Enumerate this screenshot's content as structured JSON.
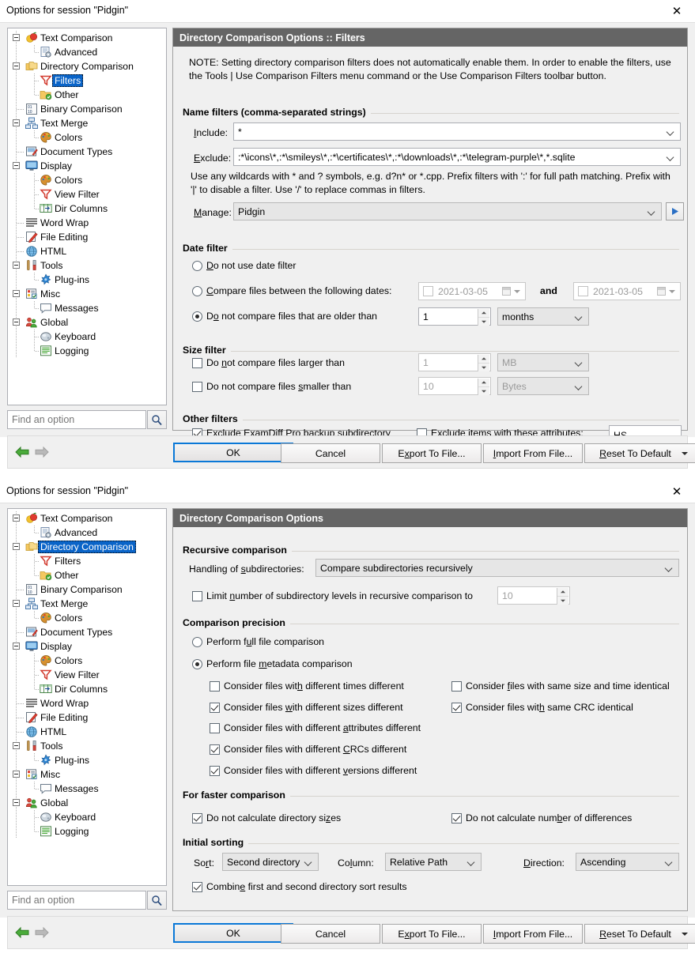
{
  "window": {
    "title": "Options for session \"Pidgin\"",
    "close_icon": "close-icon"
  },
  "tree": {
    "items": [
      {
        "label": "Text Comparison",
        "level": 0,
        "icon": "text-comparison-icon",
        "expander": true
      },
      {
        "label": "Advanced",
        "level": 1,
        "icon": "advanced-icon",
        "expander": false
      },
      {
        "label": "Directory Comparison",
        "level": 0,
        "icon": "directory-comparison-icon",
        "expander": true
      },
      {
        "label": "Filters",
        "level": 1,
        "icon": "filters-icon",
        "expander": false
      },
      {
        "label": "Other",
        "level": 1,
        "icon": "other-folder-icon",
        "expander": false
      },
      {
        "label": "Binary Comparison",
        "level": 0,
        "icon": "binary-comparison-icon",
        "expander": false
      },
      {
        "label": "Text Merge",
        "level": 0,
        "icon": "text-merge-icon",
        "expander": true
      },
      {
        "label": "Colors",
        "level": 1,
        "icon": "colors-palette-icon",
        "expander": false
      },
      {
        "label": "Document Types",
        "level": 0,
        "icon": "document-types-icon",
        "expander": false
      },
      {
        "label": "Display",
        "level": 0,
        "icon": "display-monitor-icon",
        "expander": true
      },
      {
        "label": "Colors",
        "level": 1,
        "icon": "colors-palette-icon",
        "expander": false
      },
      {
        "label": "View Filter",
        "level": 1,
        "icon": "view-filter-icon",
        "expander": false
      },
      {
        "label": "Dir Columns",
        "level": 1,
        "icon": "dir-columns-icon",
        "expander": false
      },
      {
        "label": "Word Wrap",
        "level": 0,
        "icon": "word-wrap-icon",
        "expander": false
      },
      {
        "label": "File Editing",
        "level": 0,
        "icon": "file-editing-icon",
        "expander": false
      },
      {
        "label": "HTML",
        "level": 0,
        "icon": "html-globe-icon",
        "expander": false
      },
      {
        "label": "Tools",
        "level": 0,
        "icon": "tools-icon",
        "expander": true
      },
      {
        "label": "Plug-ins",
        "level": 1,
        "icon": "plugins-icon",
        "expander": false
      },
      {
        "label": "Misc",
        "level": 0,
        "icon": "misc-icon",
        "expander": true
      },
      {
        "label": "Messages",
        "level": 1,
        "icon": "messages-icon",
        "expander": false
      },
      {
        "label": "Global",
        "level": 0,
        "icon": "global-users-icon",
        "expander": true
      },
      {
        "label": "Keyboard",
        "level": 1,
        "icon": "keyboard-icon",
        "expander": false
      },
      {
        "label": "Logging",
        "level": 1,
        "icon": "logging-icon",
        "expander": false
      }
    ],
    "selected_index_dialog1": 3,
    "selected_index_dialog2": 2
  },
  "search": {
    "placeholder": "Find an option",
    "icon": "search-magnifier-icon"
  },
  "footer": {
    "back_icon": "back-arrow-icon",
    "forward_icon": "forward-arrow-icon",
    "ok": "OK",
    "cancel": "Cancel",
    "export": "Export To File...",
    "import": "Import From File...",
    "reset": "Reset To Default"
  },
  "dialog1": {
    "panel_title": "Directory Comparison Options :: Filters",
    "note": "NOTE: Setting directory comparison filters does not automatically enable them. In order to enable the filters, use the Tools | Use Comparison Filters menu command or the Use Comparison Filters toolbar button.",
    "name_filters": {
      "group_title": "Name filters (comma-separated strings)",
      "include_label": "Include:",
      "include_value": "*",
      "exclude_label": "Exclude:",
      "exclude_value": ":*\\icons\\*,:*\\smileys\\*,:*\\certificates\\*,:*\\downloads\\*,:*\\telegram-purple\\*,*.sqlite",
      "hint": "Use any wildcards with * and ? symbols, e.g. d?n* or *.cpp. Prefix filters with ':' for full path matching. Prefix with '|' to disable a filter. Use '/' to replace commas in filters.",
      "manage_label": "Manage:",
      "manage_value": "Pidgin",
      "play_icon": "play-triangle-icon"
    },
    "date_filter": {
      "group_title": "Date filter",
      "opt_no_date": "Do not use date filter",
      "opt_no_date_checked": false,
      "opt_between": "Compare files between the following dates:",
      "opt_between_checked": false,
      "date_from": "2021-03-05",
      "and_label": "and",
      "date_to": "2021-03-05",
      "opt_older": "Do not compare files that are older than",
      "opt_older_checked": true,
      "older_value": "1",
      "older_unit": "months"
    },
    "size_filter": {
      "group_title": "Size filter",
      "larger_label": "Do not compare files larger than",
      "larger_checked": false,
      "larger_value": "1",
      "larger_unit": "MB",
      "smaller_label": "Do not compare files smaller than",
      "smaller_checked": false,
      "smaller_value": "10",
      "smaller_unit": "Bytes"
    },
    "other_filters": {
      "group_title": "Other filters",
      "exclude_backup_label": "Exclude ExamDiff Pro backup subdirectory",
      "exclude_backup_checked": true,
      "exclude_attrs_label": "Exclude items with these attributes:",
      "exclude_attrs_checked": false,
      "attrs_value": "HS"
    }
  },
  "dialog2": {
    "panel_title": "Directory Comparison Options",
    "recursive": {
      "group_title": "Recursive comparison",
      "handling_label": "Handling of subdirectories:",
      "handling_value": "Compare subdirectories recursively",
      "limit_label": "Limit number of subdirectory levels in recursive comparison to",
      "limit_checked": false,
      "limit_value": "10"
    },
    "precision": {
      "group_title": "Comparison precision",
      "full_label": "Perform full file comparison",
      "full_checked": false,
      "metadata_label": "Perform file metadata comparison",
      "metadata_checked": true,
      "left_options": [
        {
          "label": "Consider files with different times different",
          "checked": false
        },
        {
          "label": "Consider files with different sizes different",
          "checked": true
        },
        {
          "label": "Consider files with different attributes different",
          "checked": false
        },
        {
          "label": "Consider files with different CRCs different",
          "checked": true
        },
        {
          "label": "Consider files with different versions different",
          "checked": true
        }
      ],
      "right_options": [
        {
          "label": "Consider files with same size and time identical",
          "checked": false
        },
        {
          "label": "Consider files with same CRC identical",
          "checked": true
        }
      ]
    },
    "faster": {
      "group_title": "For faster comparison",
      "no_dir_sizes_label": "Do not calculate directory sizes",
      "no_dir_sizes_checked": true,
      "no_diff_count_label": "Do not calculate number of differences",
      "no_diff_count_checked": true
    },
    "sorting": {
      "group_title": "Initial sorting",
      "sort_label": "Sort:",
      "sort_value": "Second directory",
      "column_label": "Column:",
      "column_value": "Relative Path",
      "direction_label": "Direction:",
      "direction_value": "Ascending",
      "combine_label": "Combine first and second directory sort results",
      "combine_checked": true
    }
  },
  "colors": {
    "panel_header_bg": "#656565",
    "selection_blue": "#0a64c8",
    "primary_border": "#0a78d7",
    "window_bg": "#f0f0f0"
  }
}
